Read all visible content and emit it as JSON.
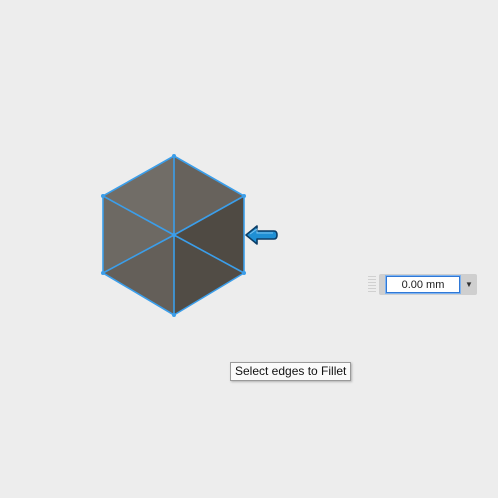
{
  "viewport": {
    "background": "#ededed"
  },
  "model": {
    "shape": "hexagonal-cube-view",
    "edge_color": "#3b9eea",
    "face_colors": [
      "#716d67",
      "#67625c",
      "#5c5851",
      "#4f4a43",
      "#5e5952",
      "#6a6660"
    ]
  },
  "edge_pointer": {
    "icon": "arrow-left-icon",
    "color": "#1f8fd4"
  },
  "dimension_input": {
    "value": "0.00 mm",
    "dropdown_icon": "triangle-down-icon"
  },
  "tooltip": {
    "text": "Select edges to Fillet"
  }
}
